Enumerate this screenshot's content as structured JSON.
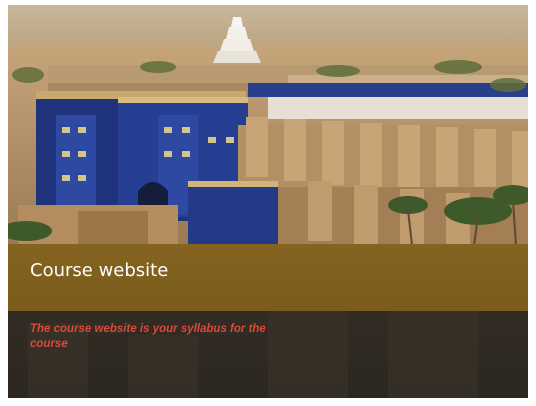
{
  "slide": {
    "title": "Course website",
    "body": "The course website is your syllabus for the course",
    "background_image": "illustration of ancient Babylon with the blue Ishtar Gate and ziggurat",
    "colors": {
      "title_band": "#84641f",
      "title_text": "#ffffff",
      "body_text": "#d94a3a",
      "gate_blue": "#223a8a"
    }
  }
}
